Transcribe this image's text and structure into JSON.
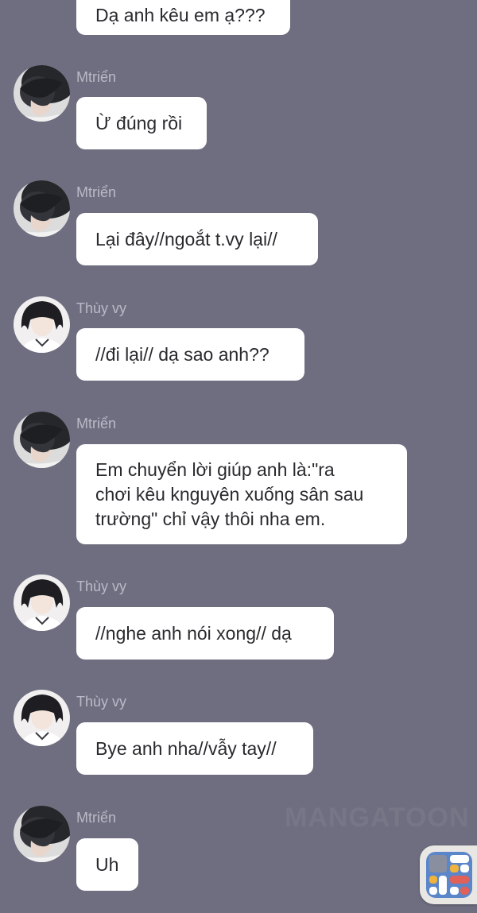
{
  "messages": [
    {
      "sender": "",
      "text": "Dạ anh kêu em ạ???"
    },
    {
      "sender": "Mtriển",
      "text": "Ừ đúng rồi"
    },
    {
      "sender": "Mtriển",
      "text": "Lại đây//ngoắt t.vy lại//"
    },
    {
      "sender": "Thùy vy",
      "text": "//đi lại// dạ sao anh??"
    },
    {
      "sender": "Mtriển",
      "text": "Em chuyển lời giúp anh là:\"ra\nchơi kêu knguyên xuống sân sau\ntrường\" chỉ vậy thôi nha em."
    },
    {
      "sender": "Thùy vy",
      "text": "//nghe anh nói xong// dạ"
    },
    {
      "sender": "Thùy vy",
      "text": "Bye anh nha//vẫy tay//"
    },
    {
      "sender": "Mtriển",
      "text": "Uh"
    }
  ],
  "watermark": "MANGATOON",
  "colors": {
    "background": "#6e6e80",
    "bubble": "#ffffff",
    "sender_name": "#b9bac6",
    "text": "#2a2a2e"
  },
  "icons": {
    "avatar_mtrien": "avatar-boy-icon",
    "avatar_thuyvy": "avatar-girl-icon",
    "floating_widget": "control-center-widget-icon"
  }
}
